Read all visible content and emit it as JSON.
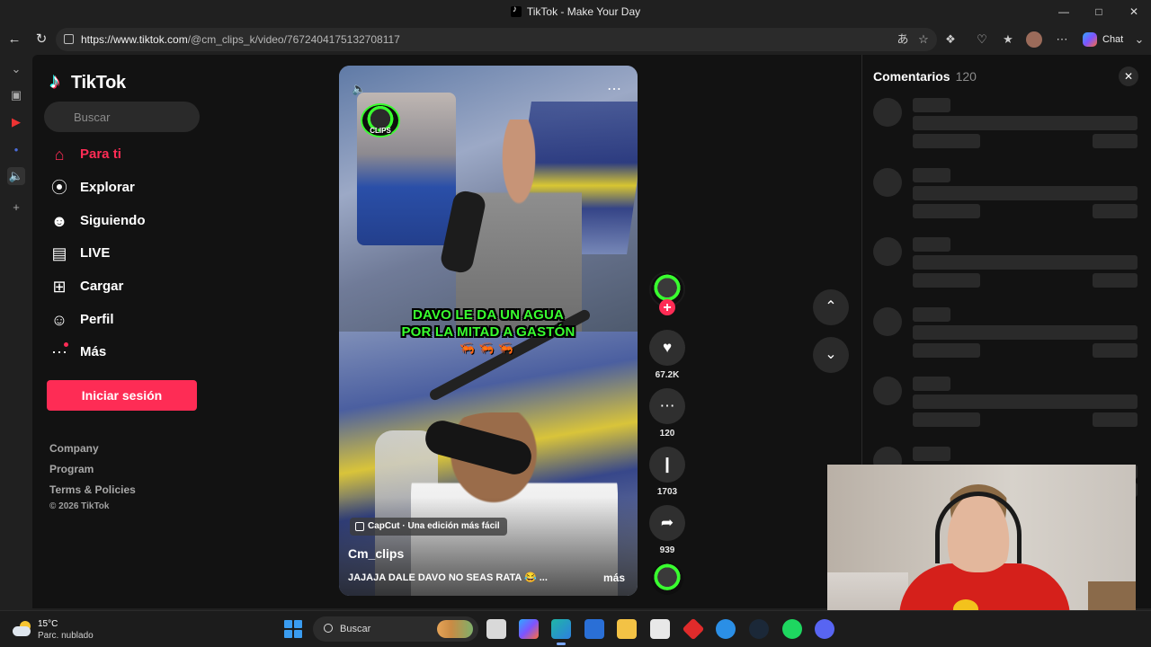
{
  "window": {
    "title": "TikTok - Make Your Day",
    "controls": [
      "minimize",
      "maximize",
      "close"
    ]
  },
  "browser": {
    "url_host": "https://www.tiktok.com",
    "url_path": "/@cm_clips_k/video/7672404175132708117",
    "chat_label": "Chat",
    "toolbar_icons": [
      "translate-icon",
      "favorite-icon",
      "extensions-icon",
      "browser-essentials-icon",
      "collections-icon",
      "profile-icon",
      "more-icon"
    ]
  },
  "sidebar": {
    "brand": "TikTok",
    "search_placeholder": "Buscar",
    "nav": [
      {
        "label": "Para ti",
        "icon": "home-icon",
        "active": true
      },
      {
        "label": "Explorar",
        "icon": "compass-icon"
      },
      {
        "label": "Siguiendo",
        "icon": "following-icon"
      },
      {
        "label": "LIVE",
        "icon": "live-icon"
      },
      {
        "label": "Cargar",
        "icon": "upload-icon"
      },
      {
        "label": "Perfil",
        "icon": "profile-icon"
      },
      {
        "label": "Más",
        "icon": "more-icon"
      }
    ],
    "login_label": "Iniciar sesión",
    "footer_links": [
      "Company",
      "Program",
      "Terms & Policies"
    ],
    "copyright": "© 2026 TikTok"
  },
  "video": {
    "caption_line1": "DAVO LE DA UN AGUA",
    "caption_line2": "POR LA MITAD A GASTÓN",
    "caption_emojis": "🦐🦐🦐",
    "watermark": "CLIPS",
    "capcut_label": "CapCut · Una edición más fácil",
    "author": "Cm_clips",
    "description": "JAJAJA DALE DAVO NO SEAS RATA 😂 ...",
    "more_label": "más"
  },
  "actions": {
    "likes": "67.2K",
    "comments": "120",
    "saves": "1703",
    "shares": "939"
  },
  "comments_panel": {
    "title": "Comentarios",
    "count": "120"
  },
  "taskbar": {
    "temperature": "15°C",
    "condition": "Parc. nublado",
    "search_label": "Buscar",
    "apps": [
      "copilot-icon",
      "edge-icon",
      "outlook-icon",
      "file-explorer-icon",
      "store-icon",
      "app-red-icon",
      "help-icon",
      "steam-icon",
      "spotify-icon",
      "discord-icon"
    ]
  },
  "colors": {
    "tiktok_red": "#fe2c55",
    "caption_green": "#39ff2f",
    "page_bg": "#121212"
  }
}
